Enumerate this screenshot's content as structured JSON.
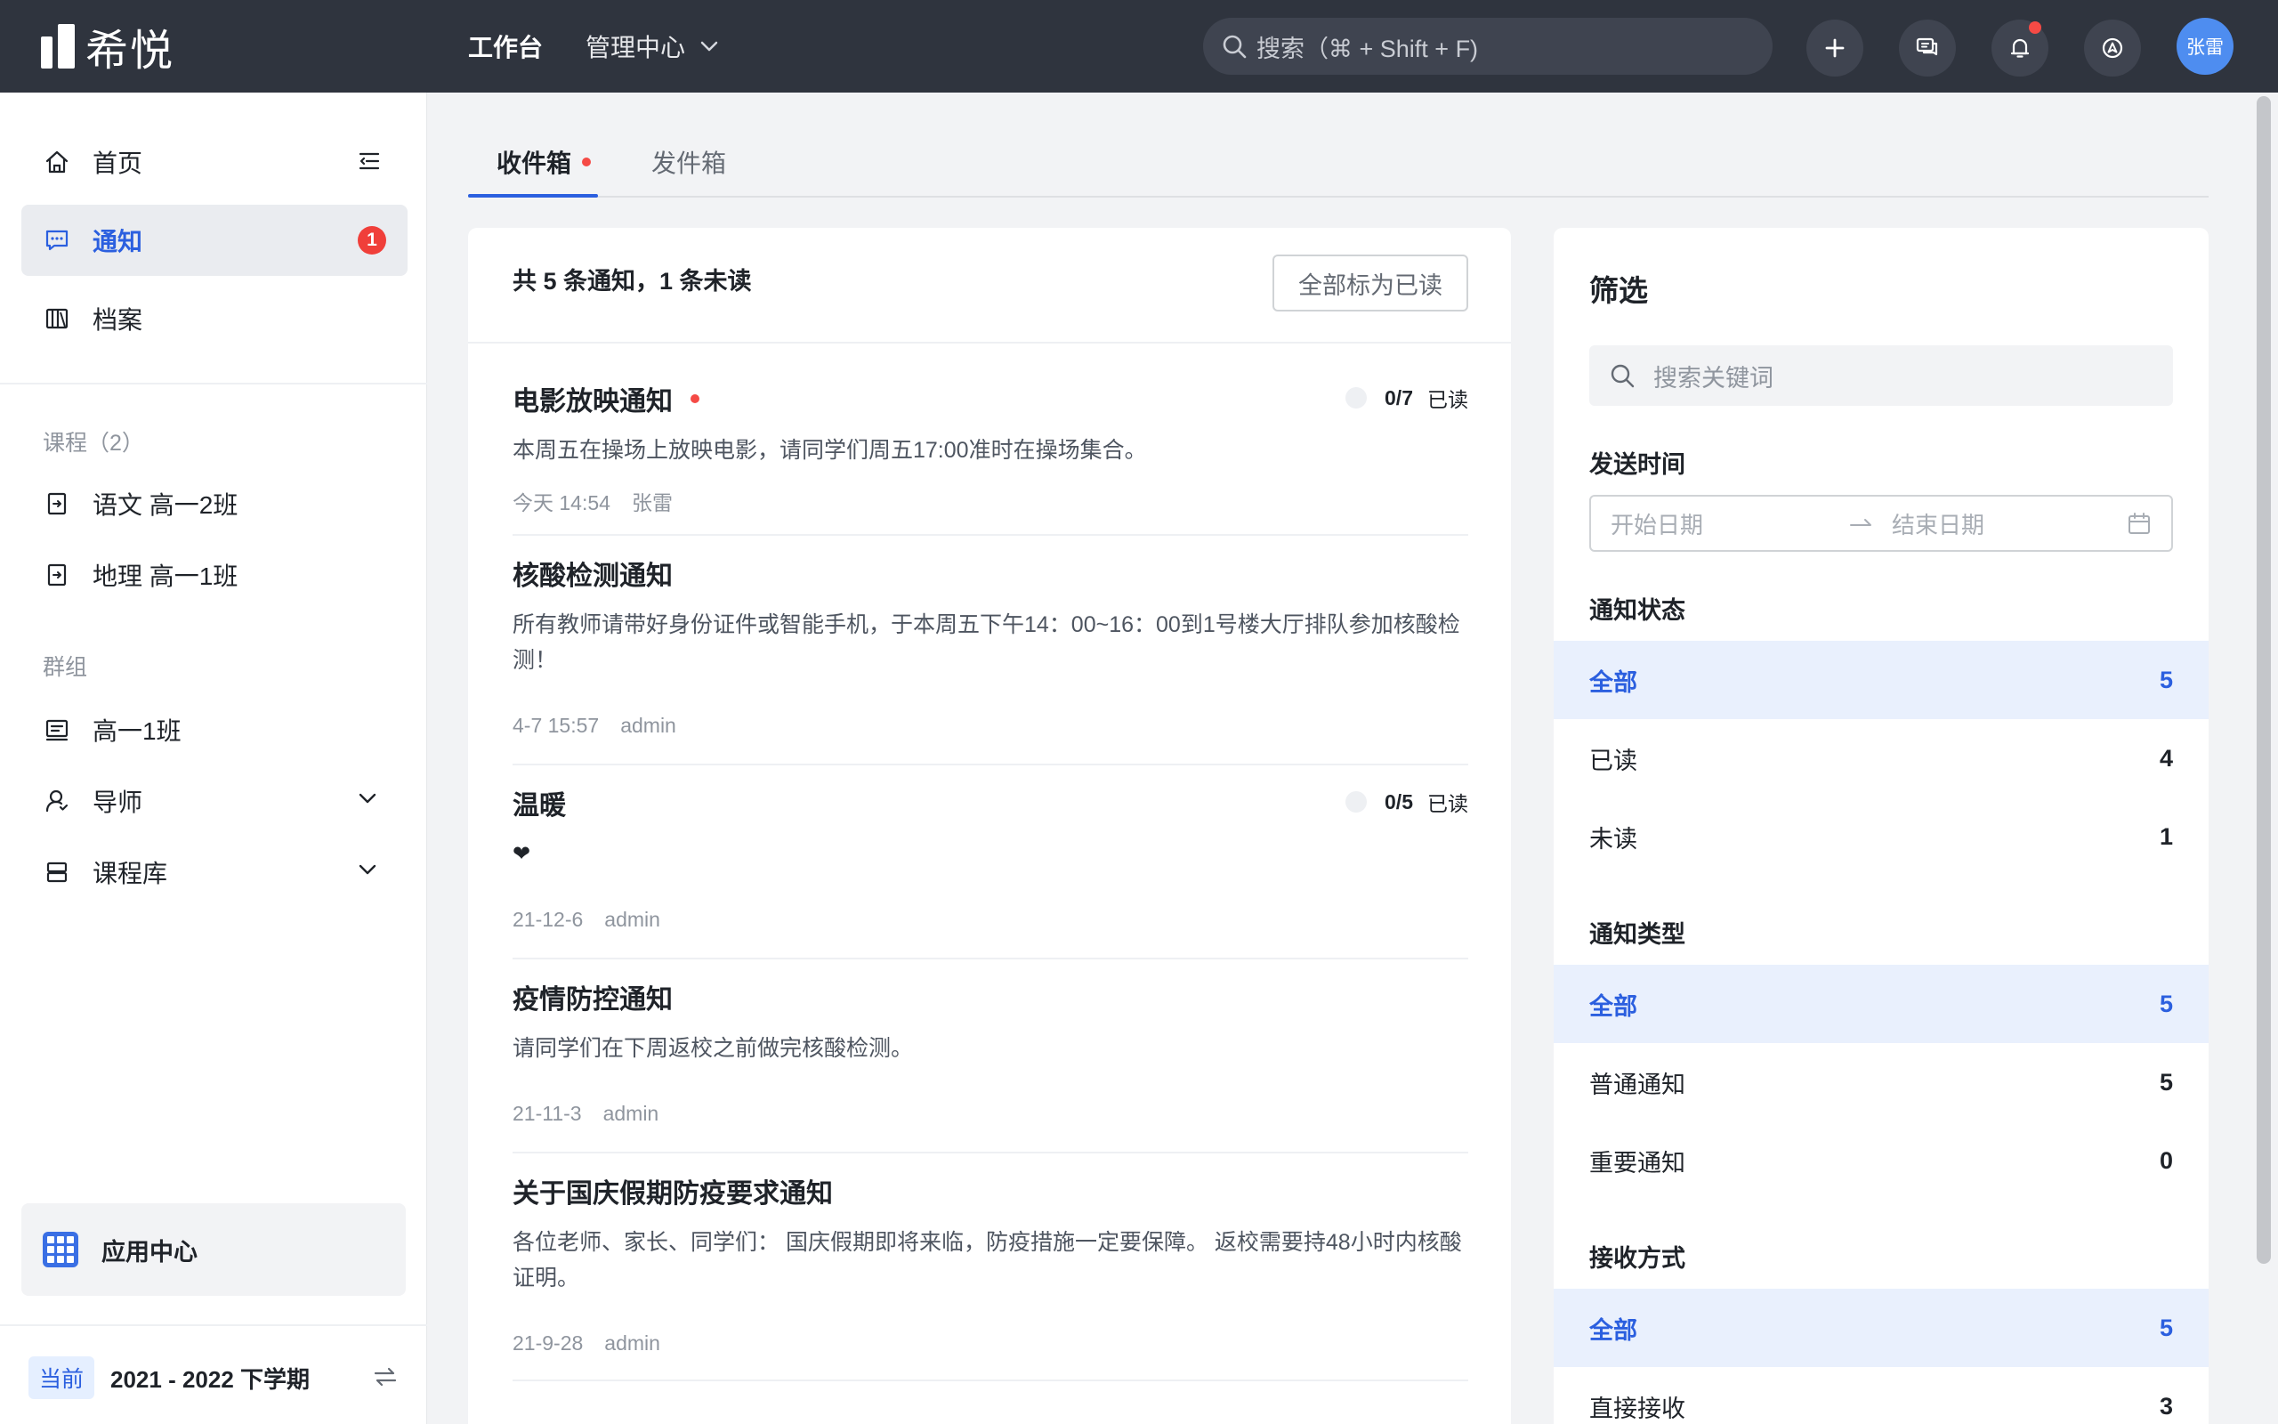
{
  "app": {
    "name": "希悦"
  },
  "nav": {
    "workbench": "工作台",
    "admin": "管理中心"
  },
  "search": {
    "placeholder": "搜索（⌘ + Shift + F)"
  },
  "user": {
    "name": "张雷"
  },
  "sidebar": {
    "home": "首页",
    "notice": "通知",
    "notice_badge": "1",
    "archive": "档案",
    "course_section": "课程（2）",
    "courses": [
      "语文 高一2班",
      "地理 高一1班"
    ],
    "group_section": "群组",
    "groups": [
      "高一1班",
      "导师",
      "课程库"
    ],
    "app_center": "应用中心",
    "term_tag": "当前",
    "term_name": "2021 - 2022 下学期"
  },
  "tabs": {
    "inbox": "收件箱",
    "outbox": "发件箱"
  },
  "list": {
    "summary": "共 5 条通知，1 条未读",
    "mark_all": "全部标为已读",
    "read_label": "已读",
    "items": [
      {
        "title": "电影放映通知",
        "body": "本周五在操场上放映电影，请同学们周五17:00准时在操场集合。",
        "time": "今天 14:54",
        "author": "张雷",
        "read": "0/7",
        "unread": true
      },
      {
        "title": "核酸检测通知",
        "body": "所有教师请带好身份证件或智能手机，于本周五下午14：00~16：00到1号楼大厅排队参加核酸检测！",
        "time": "4-7 15:57",
        "author": "admin"
      },
      {
        "title": "温暖",
        "body": "❤",
        "time": "21-12-6",
        "author": "admin",
        "read": "0/5"
      },
      {
        "title": "疫情防控通知",
        "body": "请同学们在下周返校之前做完核酸检测。",
        "time": "21-11-3",
        "author": "admin"
      },
      {
        "title": "关于国庆假期防疫要求通知",
        "body": "各位老师、家长、同学们： 国庆假期即将来临，防疫措施一定要保障。 返校需要持48小时内核酸证明。",
        "time": "21-9-28",
        "author": "admin"
      }
    ]
  },
  "filter": {
    "title": "筛选",
    "search_placeholder": "搜索关键词",
    "time_label": "发送时间",
    "date_start": "开始日期",
    "date_end": "结束日期",
    "status_label": "通知状态",
    "status": [
      {
        "label": "全部",
        "count": "5"
      },
      {
        "label": "已读",
        "count": "4"
      },
      {
        "label": "未读",
        "count": "1"
      }
    ],
    "type_label": "通知类型",
    "types": [
      {
        "label": "全部",
        "count": "5"
      },
      {
        "label": "普通通知",
        "count": "5"
      },
      {
        "label": "重要通知",
        "count": "0"
      }
    ],
    "recv_label": "接收方式",
    "recv": [
      {
        "label": "全部",
        "count": "5"
      },
      {
        "label": "直接接收",
        "count": "3"
      }
    ]
  },
  "colors": {
    "topbar": "#2f343e",
    "accent": "#2b5fdf",
    "badge": "#f03f3a",
    "selected_bg": "#e9f0fd"
  }
}
